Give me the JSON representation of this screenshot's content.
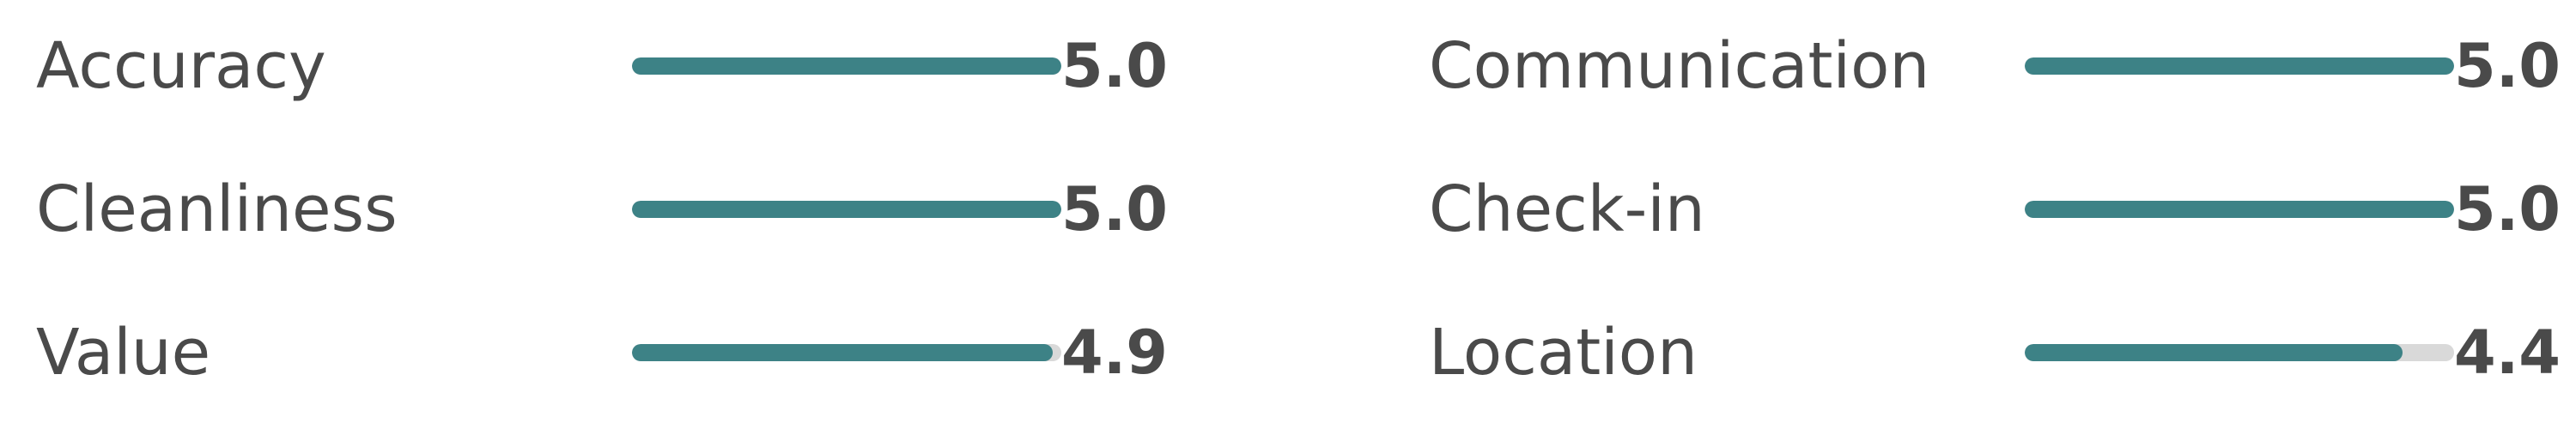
{
  "ratings": [
    {
      "label": "Accuracy",
      "score": "5.0",
      "fraction": 1.0
    },
    {
      "label": "Cleanliness",
      "score": "5.0",
      "fraction": 1.0
    },
    {
      "label": "Value",
      "score": "4.9",
      "fraction": 0.98
    },
    {
      "label": "Communication",
      "score": "5.0",
      "fraction": 1.0
    },
    {
      "label": "Check-in",
      "score": "5.0",
      "fraction": 1.0
    },
    {
      "label": "Location",
      "score": "4.4",
      "fraction": 0.88
    }
  ],
  "colors": {
    "fill": "#3d8286",
    "track": "#d9d9d9",
    "text": "#4a4a4a"
  }
}
